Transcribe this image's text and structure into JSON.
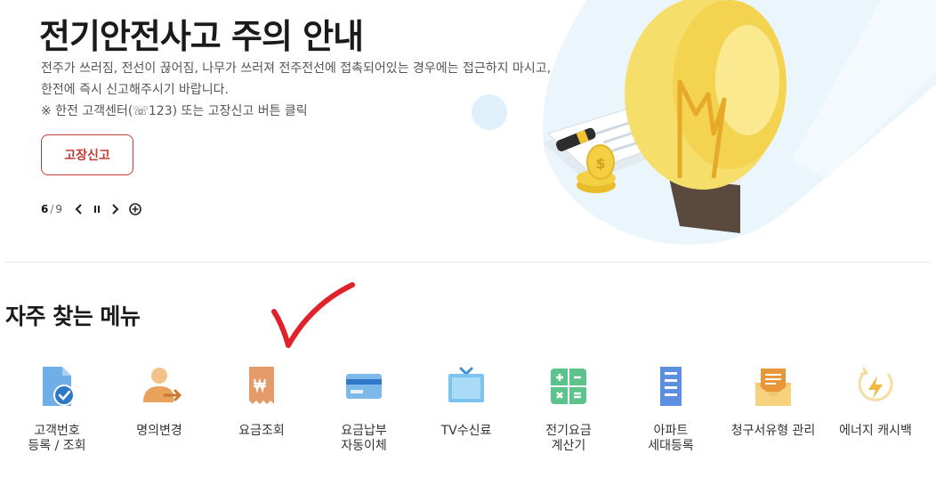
{
  "banner": {
    "title": "전기안전사고 주의 안내",
    "desc_line1": "전주가 쓰러짐, 전선이 끊어짐, 나무가 쓰러져 전주전선에 접촉되어있는 경우에는 접근하지 마시고,",
    "desc_line2": "한전에 즉시 신고해주시기 바랍니다.",
    "desc_line3": "※ 한전 고객센터(☏123) 또는 고장신고 버튼 클릭",
    "button_label": "고장신고",
    "pager": {
      "current": "6",
      "separator": "/",
      "total": "9"
    }
  },
  "quick_menu": {
    "title": "자주 찾는 메뉴",
    "items": [
      {
        "label": "고객번호\n등록 / 조회",
        "icon": "customer-document-icon"
      },
      {
        "label": "명의변경",
        "icon": "person-transfer-icon"
      },
      {
        "label": "요금조회",
        "icon": "bill-won-icon"
      },
      {
        "label": "요금납부\n자동이체",
        "icon": "credit-card-icon"
      },
      {
        "label": "TV수신료",
        "icon": "tv-icon"
      },
      {
        "label": "전기요금\n계산기",
        "icon": "calculator-icon"
      },
      {
        "label": "아파트\n세대등록",
        "icon": "apartment-icon"
      },
      {
        "label": "청구서유형 관리",
        "icon": "envelope-icon"
      },
      {
        "label": "에너지 캐시백",
        "icon": "energy-cashback-icon"
      }
    ]
  },
  "colors": {
    "accent_red": "#c43b35",
    "icon_blue": "#6faee6",
    "icon_orange": "#e8a25a",
    "icon_green": "#5cc48a",
    "icon_yellow": "#f1b944",
    "checkmark_red": "#e0222a"
  }
}
